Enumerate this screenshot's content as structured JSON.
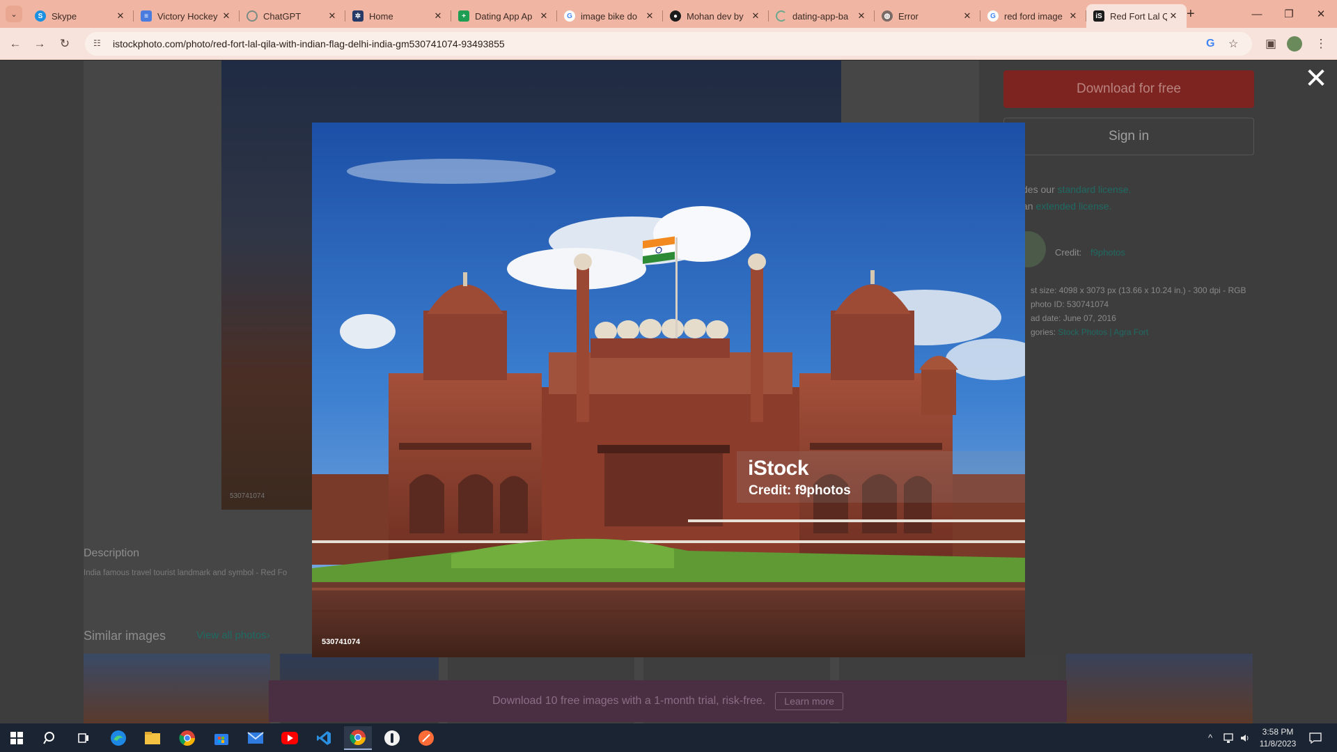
{
  "tabs": [
    {
      "title": "Skype",
      "icon": "skype-icon",
      "color": "#1b8fe0"
    },
    {
      "title": "Victory Hockey",
      "icon": "docs-icon",
      "color": "#4a7ce0"
    },
    {
      "title": "ChatGPT",
      "icon": "chatgpt-icon",
      "color": "#7a8b86"
    },
    {
      "title": "Home",
      "icon": "home-app-icon",
      "color": "#253a66"
    },
    {
      "title": "Dating App Ap",
      "icon": "sheets-icon",
      "color": "#1e9e53"
    },
    {
      "title": "image bike do",
      "icon": "google-icon",
      "color": "#ffffff"
    },
    {
      "title": "Mohan dev by",
      "icon": "github-icon",
      "color": "#1b1b1b"
    },
    {
      "title": "dating-app-ba",
      "icon": "loading-icon",
      "color": "#6aa88f"
    },
    {
      "title": "Error",
      "icon": "globe-icon",
      "color": "#7a6a66"
    },
    {
      "title": "red ford image",
      "icon": "google-icon",
      "color": "#ffffff"
    }
  ],
  "active_tab": {
    "title": "Red Fort Lal Qi",
    "icon": "istock-icon"
  },
  "new_tab_label": "+",
  "address_bar": {
    "url": "istockphoto.com/photo/red-fort-lal-qila-with-indian-flag-delhi-india-gm530741074-93493855"
  },
  "page": {
    "download_btn": "Download for free",
    "signin_btn": "Sign in",
    "license_line1_prefix": "des our",
    "license_line1_link": "standard license.",
    "license_line2_prefix": "an",
    "license_line2_link": "extended license.",
    "credit_label": "Credit:",
    "credit_name": "f9photos",
    "meta_size": "st size: 4098 x 3073 px (13.66 x 10.24 in.) - 300 dpi - RGB",
    "meta_id": "photo ID: 530741074",
    "meta_date": "ad date: June 07, 2016",
    "meta_cat_prefix": "gories:",
    "meta_cat_links": "Stock Photos | Agra Fort",
    "bg_photo_id": "530741074",
    "description_title": "Description",
    "description_text": "India famous travel tourist landmark and symbol - Red Fo",
    "similar_title": "Similar images",
    "view_all": "View all photos›",
    "promo_text": "Download 10 free images with a 1-month trial, risk-free.",
    "promo_link": "Learn more"
  },
  "lightbox": {
    "watermark_brand": "iStock",
    "watermark_credit": "Credit: f9photos",
    "image_id": "530741074",
    "close_icon": "close-icon"
  },
  "taskbar": {
    "apps": [
      "windows-start-icon",
      "search-icon",
      "task-view-icon",
      "edge-icon",
      "file-explorer-icon",
      "chrome-icon",
      "store-icon",
      "mail-icon",
      "youtube-icon",
      "vscode-icon",
      "chrome-active-icon",
      "circle-app-icon",
      "postman-icon"
    ],
    "time": "3:58 PM",
    "date": "11/8/2023"
  },
  "colors": {
    "tabstrip": "#f1b6a3",
    "toolbar": "#f7e3dc",
    "download_btn": "#7d2420",
    "link": "#1f6b63",
    "taskbar": "#1b2432"
  }
}
